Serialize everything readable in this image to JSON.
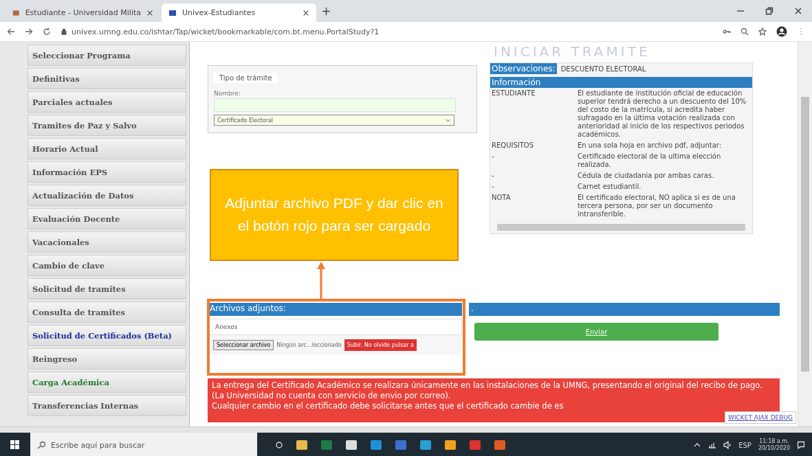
{
  "browser": {
    "tabs": [
      {
        "title": "Estudiante - Universidad Milita",
        "selected": false
      },
      {
        "title": "Univex-Estudiantes",
        "selected": true
      }
    ],
    "url": "univex.umng.edu.co/ishtar/Tap/wicket/bookmarkable/com.bt.menu.PortalStudy?1"
  },
  "sidebar": {
    "items": [
      {
        "label": "Seleccionar Programa",
        "color": "#555555"
      },
      {
        "label": "Definitivas",
        "color": "#555555"
      },
      {
        "label": "Parciales actuales",
        "color": "#555555"
      },
      {
        "label": "Tramites de Paz y Salvo",
        "color": "#555555"
      },
      {
        "label": "Horario Actual",
        "color": "#555555"
      },
      {
        "label": "Información EPS",
        "color": "#555555"
      },
      {
        "label": "Actualización de Datos",
        "color": "#555555"
      },
      {
        "label": "Evaluación Docente",
        "color": "#555555"
      },
      {
        "label": "Vacacionales",
        "color": "#555555"
      },
      {
        "label": "Cambio de clave",
        "color": "#555555"
      },
      {
        "label": "Solicitud de tramites",
        "color": "#555555"
      },
      {
        "label": "Consulta de tramites",
        "color": "#555555"
      },
      {
        "label": "Solicitud de Certificados (Beta)",
        "color": "#1f2f9a"
      },
      {
        "label": "Reingreso",
        "color": "#555555"
      },
      {
        "label": "Carga Académica",
        "color": "#1e7a2a"
      },
      {
        "label": "Transferencias Internas",
        "color": "#555555"
      }
    ]
  },
  "page_title": "INICIAR TRAMITE",
  "form": {
    "legend": "Tipo de trámite",
    "name_label": "Nombre:",
    "select_value": "Certificado Electoral"
  },
  "observations": {
    "label": "Observaciones:",
    "value": "DESCUENTO ELECTORAL"
  },
  "info": {
    "heading": "Información",
    "rows": [
      {
        "label": "ESTUDIANTE",
        "text": "El estudiante de institución oficial de educación superior tendrá derecho a un descuento del 10% del costo de la matrícula, si acredita haber sufragado en la última votación realizada con anterioridad al inicio de los respectivos periodos académicos."
      },
      {
        "label": "REQUISITOS",
        "text": "En una sola hoja en archivo pdf, adjuntar:"
      },
      {
        "label": "-",
        "text": "Certificado electoral de la ultima elección realizada."
      },
      {
        "label": "-",
        "text": "Cédula de ciudadania por ambas caras."
      },
      {
        "label": "-",
        "text": "Carnet estudiantil."
      },
      {
        "label": "NOTA",
        "text": "El certificado electoral, NO aplica si es de una tercera persona, por ser un documento intransferible."
      }
    ]
  },
  "attachments": {
    "heading": "Archivos adjuntos:",
    "right_heading": ".",
    "annex_label": "Anexos",
    "file_button": "Seleccionar archivo",
    "file_status": "Ningún arc…leccionado",
    "upload_button": "Subir. No olvide pulsar a",
    "send_button": "Enviar"
  },
  "notice": [
    "La entrega del Certificado Académico se realizara únicamente en las instalaciones de la UMNG, presentando el original del recibo de pago. (La Universidad no cuenta con servicio de envio por correo).",
    "Cualquier cambio en el certificado debe solicitarse antes que el certificado cambie de es"
  ],
  "debug_link": "WICKET AJAX DEBUG",
  "callout": "Adjuntar archivo PDF y dar clic en el botón rojo para ser cargado",
  "taskbar": {
    "search_placeholder": "Escribe aquí para buscar",
    "language": "ESP",
    "time": "11:18 a.m.",
    "date": "20/10/2020"
  }
}
